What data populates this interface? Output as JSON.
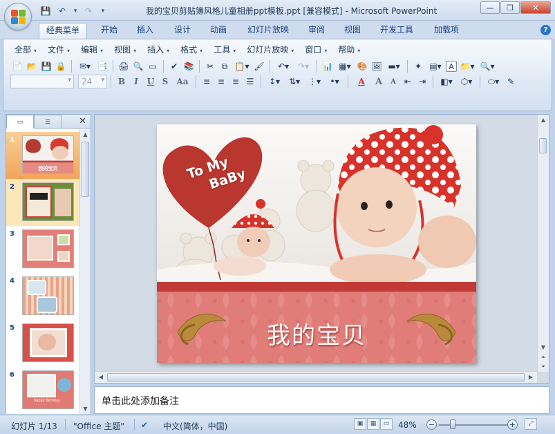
{
  "window": {
    "title": "我的宝贝剪贴簿风格儿童相册ppt模板.ppt [兼容模式] - Microsoft PowerPoint",
    "controls": {
      "minimize": "—",
      "restore": "❐",
      "close": "✕"
    }
  },
  "quick_access": {
    "icons": [
      "save-icon",
      "undo-icon",
      "redo-icon",
      "customize-icon"
    ],
    "glyphs": {
      "save": "💾",
      "undo": "↶",
      "undo_dd": "▾",
      "redo": "↷",
      "customize": "▾"
    }
  },
  "ribbon_tabs": [
    {
      "label": "经典菜单",
      "active": true
    },
    {
      "label": "开始"
    },
    {
      "label": "插入"
    },
    {
      "label": "设计"
    },
    {
      "label": "动画"
    },
    {
      "label": "幻灯片放映"
    },
    {
      "label": "审阅"
    },
    {
      "label": "视图"
    },
    {
      "label": "开发工具"
    },
    {
      "label": "加载项"
    }
  ],
  "help_label": "?",
  "classic_menu": [
    "全部",
    "文件",
    "编辑",
    "视图",
    "插入",
    "格式",
    "工具",
    "幻灯片放映",
    "窗口",
    "帮助"
  ],
  "font_combo": {
    "font": "",
    "size": "24"
  },
  "format_buttons": {
    "bold": "B",
    "italic": "I",
    "underline": "U",
    "strike": "S",
    "case": "Aa",
    "text_color": "A",
    "grow": "A",
    "shrink": "A"
  },
  "text_box_label": "A",
  "panel": {
    "tab_outline_icon": "outline-icon",
    "close_glyph": "✕"
  },
  "slides": [
    {
      "number": "1",
      "selected": true,
      "caption": "我的宝贝"
    },
    {
      "number": "2",
      "hover": true,
      "caption": ""
    },
    {
      "number": "3"
    },
    {
      "number": "4"
    },
    {
      "number": "5"
    },
    {
      "number": "6",
      "caption": "Happy Birthday"
    }
  ],
  "current_slide": {
    "heart_text_line1": "To My",
    "heart_text_line2": "BaBy",
    "banner_title": "我的宝贝"
  },
  "notes_placeholder": "单击此处添加备注",
  "status": {
    "slide_counter": "幻灯片 1/13",
    "theme": "\"Office 主题\"",
    "language": "中文(简体，中国)",
    "zoom": "48%",
    "zoom_level": 0.48,
    "zoom_out": "−",
    "zoom_in": "+"
  },
  "colors": {
    "accent": "#c8322d",
    "selected_thumb": "#f2a45a",
    "ribbon_bg": "#dfe9f5"
  }
}
